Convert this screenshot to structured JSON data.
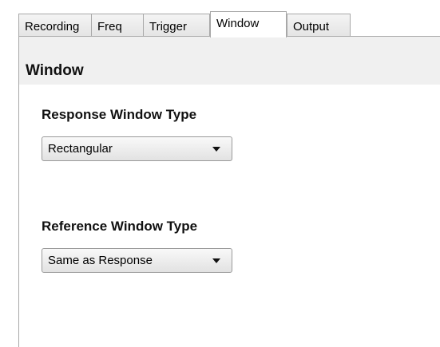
{
  "tabs": [
    {
      "label": "Recording"
    },
    {
      "label": "Freq"
    },
    {
      "label": "Trigger"
    },
    {
      "label": "Window",
      "active": true
    },
    {
      "label": "Output"
    }
  ],
  "panel": {
    "title": "Window",
    "response_window": {
      "label": "Response Window Type",
      "selected": "Rectangular"
    },
    "reference_window": {
      "label": "Reference Window Type",
      "selected": "Same as Response"
    }
  }
}
